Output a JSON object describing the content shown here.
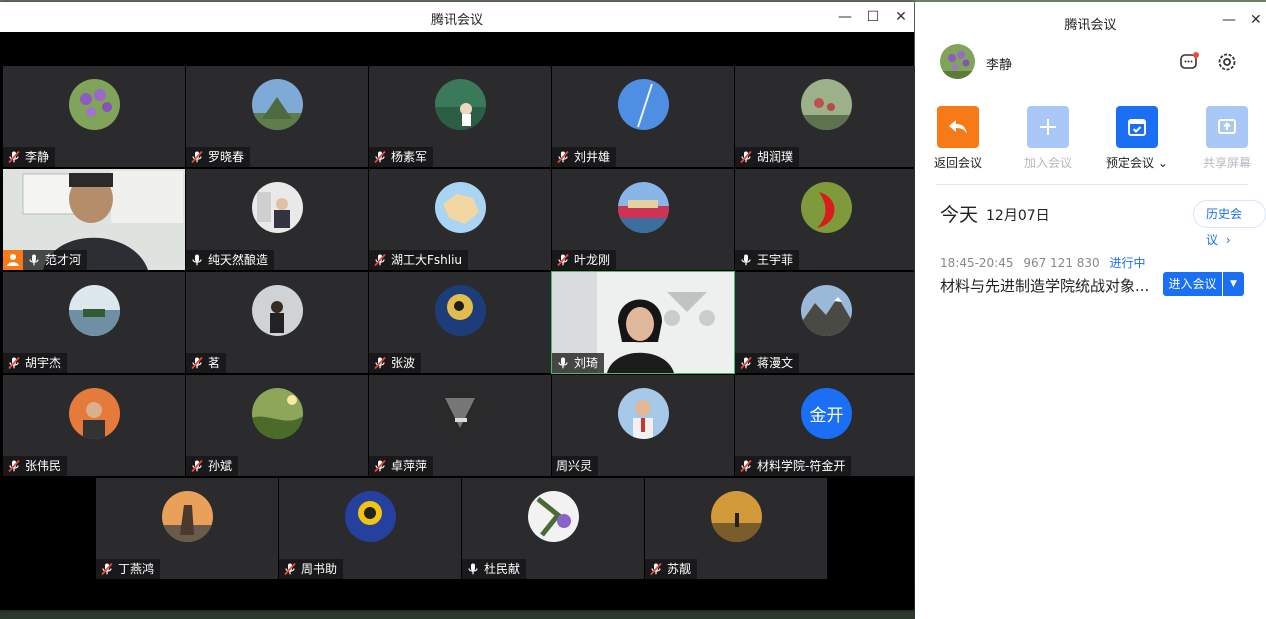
{
  "meeting_window": {
    "title": "腾讯会议",
    "minimize": "—",
    "maximize": "☐",
    "close": "✕"
  },
  "participants": [
    {
      "name": "李静",
      "muted": true
    },
    {
      "name": "罗晓春",
      "muted": true
    },
    {
      "name": "杨素军",
      "muted": true
    },
    {
      "name": "刘井雄",
      "muted": true
    },
    {
      "name": "胡润璞",
      "muted": true
    },
    {
      "name": "范才河",
      "muted": false,
      "host": true,
      "video": true
    },
    {
      "name": "纯天然酿造",
      "muted": false
    },
    {
      "name": "湖工大Fshliu",
      "muted": true
    },
    {
      "name": "叶龙刚",
      "muted": true
    },
    {
      "name": "王宇菲",
      "muted": false
    },
    {
      "name": "胡宇杰",
      "muted": true
    },
    {
      "name": "茗",
      "muted": true
    },
    {
      "name": "张波",
      "muted": true
    },
    {
      "name": "刘琦",
      "muted": false,
      "video": true
    },
    {
      "name": "蒋漫文",
      "muted": true
    },
    {
      "name": "张伟民",
      "muted": true
    },
    {
      "name": "孙斌",
      "muted": true
    },
    {
      "name": "卓萍萍",
      "muted": true
    },
    {
      "name": "周兴灵",
      "muted": false,
      "no_mic": true
    },
    {
      "name": "材料学院-符金开",
      "muted": true,
      "avatar_text": "金开"
    },
    {
      "name": "丁燕鸿",
      "muted": true
    },
    {
      "name": "周书助",
      "muted": true
    },
    {
      "name": "杜民献",
      "muted": false
    },
    {
      "name": "苏靓",
      "muted": true
    }
  ],
  "panel": {
    "title": "腾讯会议",
    "minimize": "—",
    "close": "✕",
    "user_name": "李静",
    "quick_actions": [
      {
        "label": "返回会议",
        "color": "#f77a16",
        "enabled": true
      },
      {
        "label": "加入会议",
        "color": "#a9c8f8",
        "enabled": false
      },
      {
        "label": "预定会议",
        "color": "#1a6ff5",
        "enabled": true
      },
      {
        "label": "共享屏幕",
        "color": "#a9c8f8",
        "enabled": false
      }
    ],
    "today_label": "今天",
    "date": "12月07日",
    "history_button": "历史会议",
    "meeting": {
      "time": "18:45-20:45",
      "id": "967 121 830",
      "status": "进行中",
      "title": "材料与先进制造学院统战对象...",
      "join_label": "进入会议"
    }
  }
}
